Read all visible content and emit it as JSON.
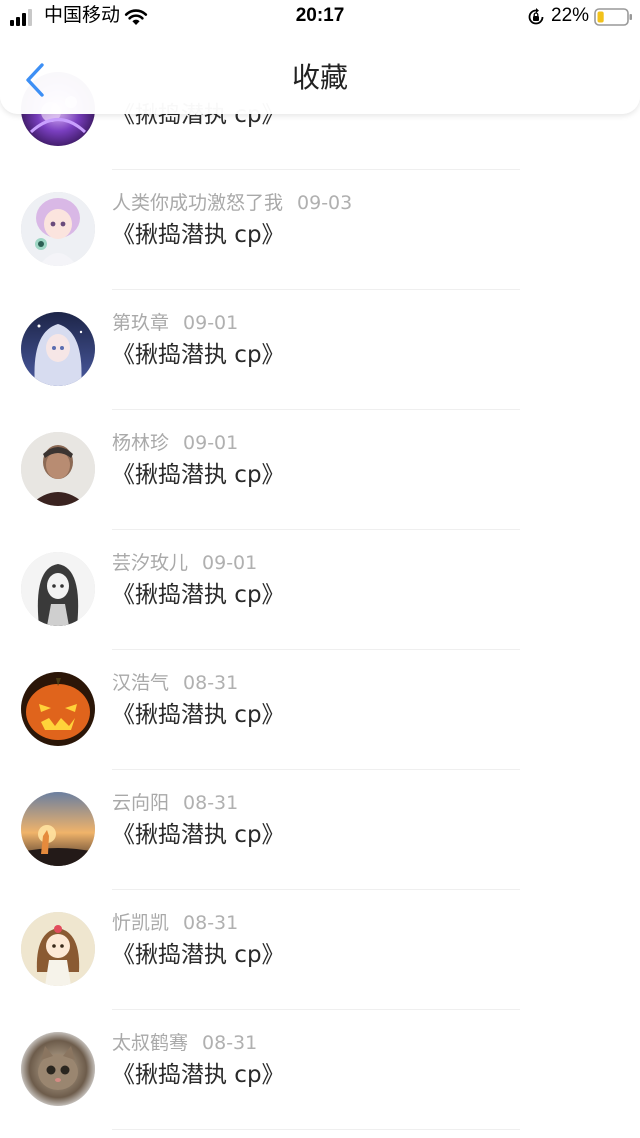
{
  "status_bar": {
    "carrier": "中国移动",
    "time": "20:17",
    "battery_percent": "22%",
    "battery_level": 0.22,
    "battery_color": "#f2c21b"
  },
  "nav": {
    "title": "收藏",
    "back_icon": "chevron-left-icon",
    "accent": "#3d8ff5"
  },
  "items": [
    {
      "user": "",
      "date": "",
      "title": "《揪捣潜执 cp》",
      "avatar": "purple-fantasy"
    },
    {
      "user": "人类你成功激怒了我",
      "date": "09-03",
      "title": "《揪捣潜执 cp》",
      "avatar": "doll-girl"
    },
    {
      "user": "第玖章",
      "date": "09-01",
      "title": "《揪捣潜执 cp》",
      "avatar": "anime-silver-hair"
    },
    {
      "user": "杨林珍",
      "date": "09-01",
      "title": "《揪捣潜执 cp》",
      "avatar": "elderly-woman-photo"
    },
    {
      "user": "芸汐玫儿",
      "date": "09-01",
      "title": "《揪捣潜执 cp》",
      "avatar": "anime-sketch-girl"
    },
    {
      "user": "汉浩气",
      "date": "08-31",
      "title": "《揪捣潜执 cp》",
      "avatar": "pumpkin-lantern"
    },
    {
      "user": "云向阳",
      "date": "08-31",
      "title": "《揪捣潜执 cp》",
      "avatar": "sunset-silhouette"
    },
    {
      "user": "忻凯凯",
      "date": "08-31",
      "title": "《揪捣潜执 cp》",
      "avatar": "chibi-girl"
    },
    {
      "user": "太叔鹤骞",
      "date": "08-31",
      "title": "《揪捣潜执 cp》",
      "avatar": "cat-photo"
    }
  ]
}
